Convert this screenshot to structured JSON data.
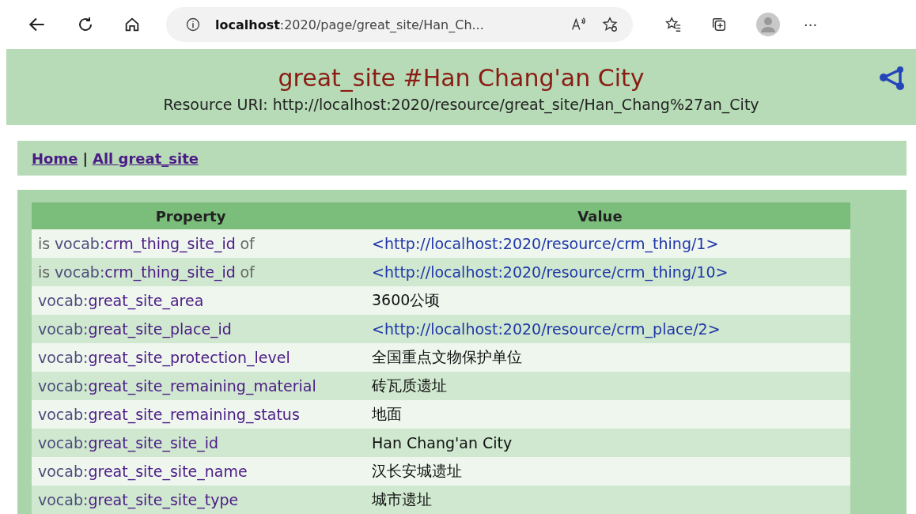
{
  "browser": {
    "address_host": "localhost",
    "address_rest": ":2020/page/great_site/Han_Ch...",
    "more": "···"
  },
  "header": {
    "title": "great_site #Han Chang'an City",
    "uri": "Resource URI: http://localhost:2020/resource/great_site/Han_Chang%27an_City"
  },
  "nav": {
    "links": [
      "Home",
      "All great_site"
    ],
    "separator": "|"
  },
  "table": {
    "columns": [
      "Property",
      "Value"
    ],
    "rows": [
      {
        "kind": "inverse",
        "pre": "is",
        "prefix": "vocab:",
        "name": "crm_thing_site_id",
        "post": "of",
        "value": {
          "kind": "link",
          "text": "<http://localhost:2020/resource/crm_thing/1>"
        }
      },
      {
        "kind": "inverse",
        "pre": "is",
        "prefix": "vocab:",
        "name": "crm_thing_site_id",
        "post": "of",
        "value": {
          "kind": "link",
          "text": "<http://localhost:2020/resource/crm_thing/10>"
        }
      },
      {
        "kind": "direct",
        "prefix": "vocab:",
        "name": "great_site_area",
        "value": {
          "kind": "literal",
          "text": "3600公顷"
        }
      },
      {
        "kind": "direct",
        "prefix": "vocab:",
        "name": "great_site_place_id",
        "value": {
          "kind": "link",
          "text": "<http://localhost:2020/resource/crm_place/2>"
        }
      },
      {
        "kind": "direct",
        "prefix": "vocab:",
        "name": "great_site_protection_level",
        "value": {
          "kind": "literal",
          "text": "全国重点文物保护单位"
        }
      },
      {
        "kind": "direct",
        "prefix": "vocab:",
        "name": "great_site_remaining_material",
        "value": {
          "kind": "literal",
          "text": "砖瓦质遗址"
        }
      },
      {
        "kind": "direct",
        "prefix": "vocab:",
        "name": "great_site_remaining_status",
        "value": {
          "kind": "literal",
          "text": "地面"
        }
      },
      {
        "kind": "direct",
        "prefix": "vocab:",
        "name": "great_site_site_id",
        "value": {
          "kind": "literal",
          "text": "Han Chang'an City"
        }
      },
      {
        "kind": "direct",
        "prefix": "vocab:",
        "name": "great_site_site_name",
        "value": {
          "kind": "literal",
          "text": "汉长安城遗址"
        }
      },
      {
        "kind": "direct",
        "prefix": "vocab:",
        "name": "great_site_site_type",
        "value": {
          "kind": "literal",
          "text": "城市遗址"
        }
      }
    ]
  }
}
